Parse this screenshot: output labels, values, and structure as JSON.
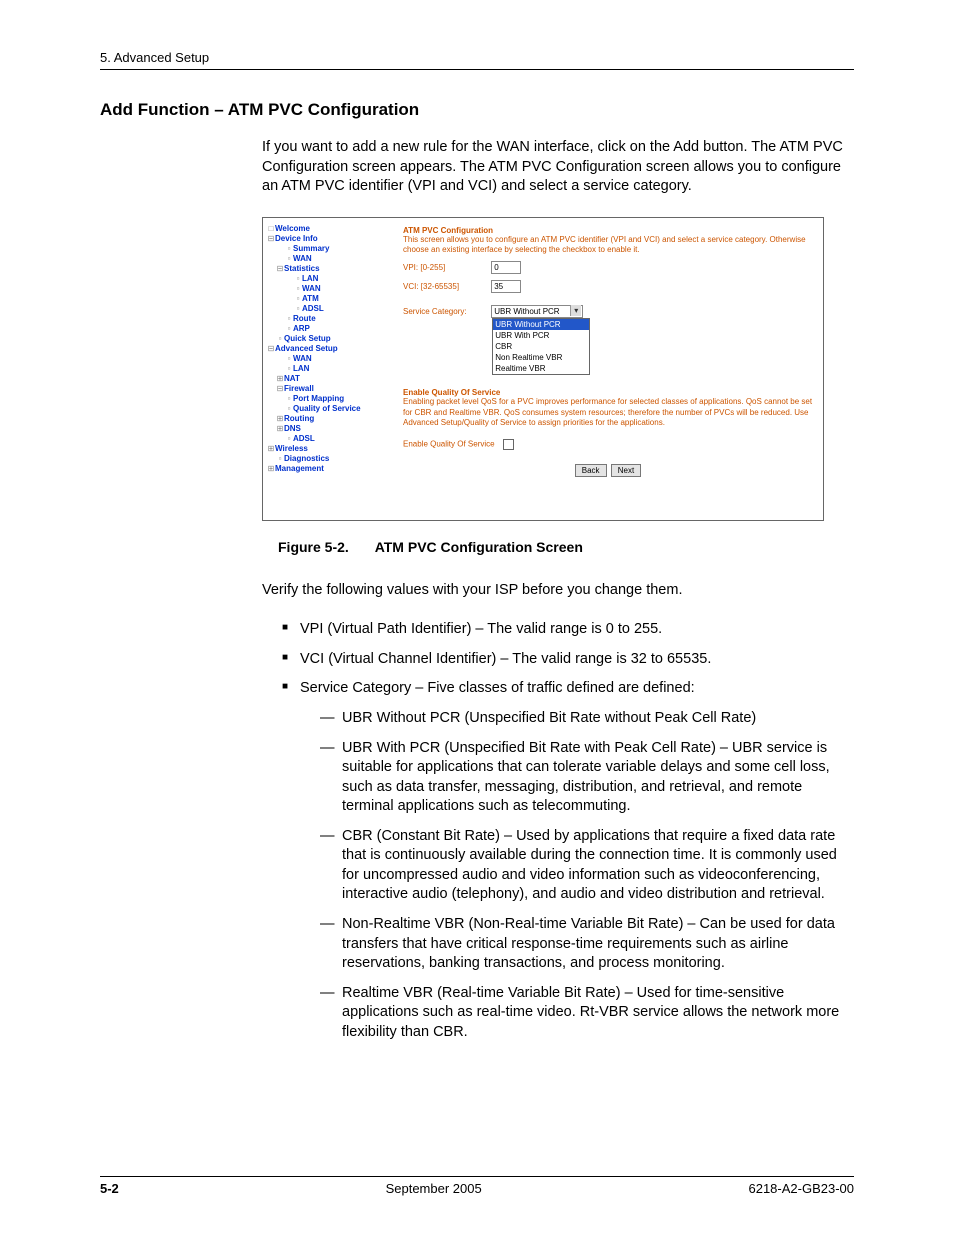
{
  "header": {
    "chapter": "5. Advanced Setup"
  },
  "section": {
    "title": "Add Function – ATM PVC Configuration"
  },
  "para1": "If you want to add a new rule for the WAN interface, click on the Add button. The ATM PVC Configuration screen appears. The ATM PVC Configuration screen allows you to configure an ATM PVC identifier (VPI and VCI) and select a service category.",
  "screenshot": {
    "tree": {
      "welcome": "Welcome",
      "device_info": "Device Info",
      "summary": "Summary",
      "wan1": "WAN",
      "statistics": "Statistics",
      "lan1": "LAN",
      "wan2": "WAN",
      "atm": "ATM",
      "adsl1": "ADSL",
      "route": "Route",
      "arp": "ARP",
      "quick_setup": "Quick Setup",
      "advanced_setup": "Advanced Setup",
      "wan3": "WAN",
      "lan2": "LAN",
      "nat": "NAT",
      "firewall": "Firewall",
      "port_mapping": "Port Mapping",
      "qos": "Quality of Service",
      "routing": "Routing",
      "dns": "DNS",
      "adsl2": "ADSL",
      "wireless": "Wireless",
      "diagnostics": "Diagnostics",
      "management": "Management"
    },
    "content": {
      "title": "ATM PVC Configuration",
      "desc": "This screen allows you to configure an ATM PVC identifier (VPI and VCI) and select a service category. Otherwise choose an existing interface by selecting the checkbox to enable it.",
      "vpi_label": "VPI: [0-255]",
      "vpi_value": "0",
      "vci_label": "VCI: [32-65535]",
      "vci_value": "35",
      "svc_label": "Service Category:",
      "svc_value": "UBR Without PCR",
      "dd_opts": {
        "o1": "UBR Without PCR",
        "o2": "UBR With PCR",
        "o3": "CBR",
        "o4": "Non Realtime VBR",
        "o5": "Realtime VBR"
      },
      "qos_hdr": "Enable Quality Of Service",
      "qos_desc": "Enabling packet level QoS for a PVC improves performance for selected classes of applications.  QoS cannot be set for CBR and Realtime VBR.  QoS consumes system resources; therefore the number of PVCs will be reduced. Use Advanced Setup/Quality of Service to assign priorities for the applications.",
      "qos_label": "Enable Quality Of Service",
      "back": "Back",
      "next": "Next"
    }
  },
  "figure": {
    "num": "Figure 5-2.",
    "title": "ATM PVC Configuration Screen"
  },
  "para2": "Verify the following values with your ISP before you change them.",
  "bullets": {
    "b1": "VPI (Virtual Path Identifier) – The valid range is 0 to 255.",
    "b2": "VCI  (Virtual Channel Identifier) – The valid range is 32 to 65535.",
    "b3": "Service Category – Five classes of traffic defined are defined:",
    "s1": "UBR Without PCR (Unspecified Bit Rate without Peak Cell Rate)",
    "s2": "UBR With PCR (Unspecified Bit Rate with Peak Cell Rate) – UBR service is suitable for applications that can tolerate variable delays and some cell loss, such as data transfer, messaging, distribution, and retrieval, and remote terminal applications such as telecommuting.",
    "s3": "CBR (Constant Bit Rate) – Used by applications that require a fixed data rate that is continuously available during the connection time. It is commonly used for uncompressed audio and video information such as videoconferencing, interactive audio (telephony), and audio and video distribution and retrieval.",
    "s4": "Non-Realtime VBR (Non-Real-time Variable Bit Rate) – Can be used for data transfers that have critical response-time requirements such as airline reservations, banking transactions, and process monitoring.",
    "s5": "Realtime VBR  (Real-time Variable Bit Rate) – Used for time-sensitive applications such as real-time video. Rt-VBR service allows the network more flexibility than CBR."
  },
  "footer": {
    "page": "5-2",
    "date": "September 2005",
    "doc": "6218-A2-GB23-00"
  }
}
